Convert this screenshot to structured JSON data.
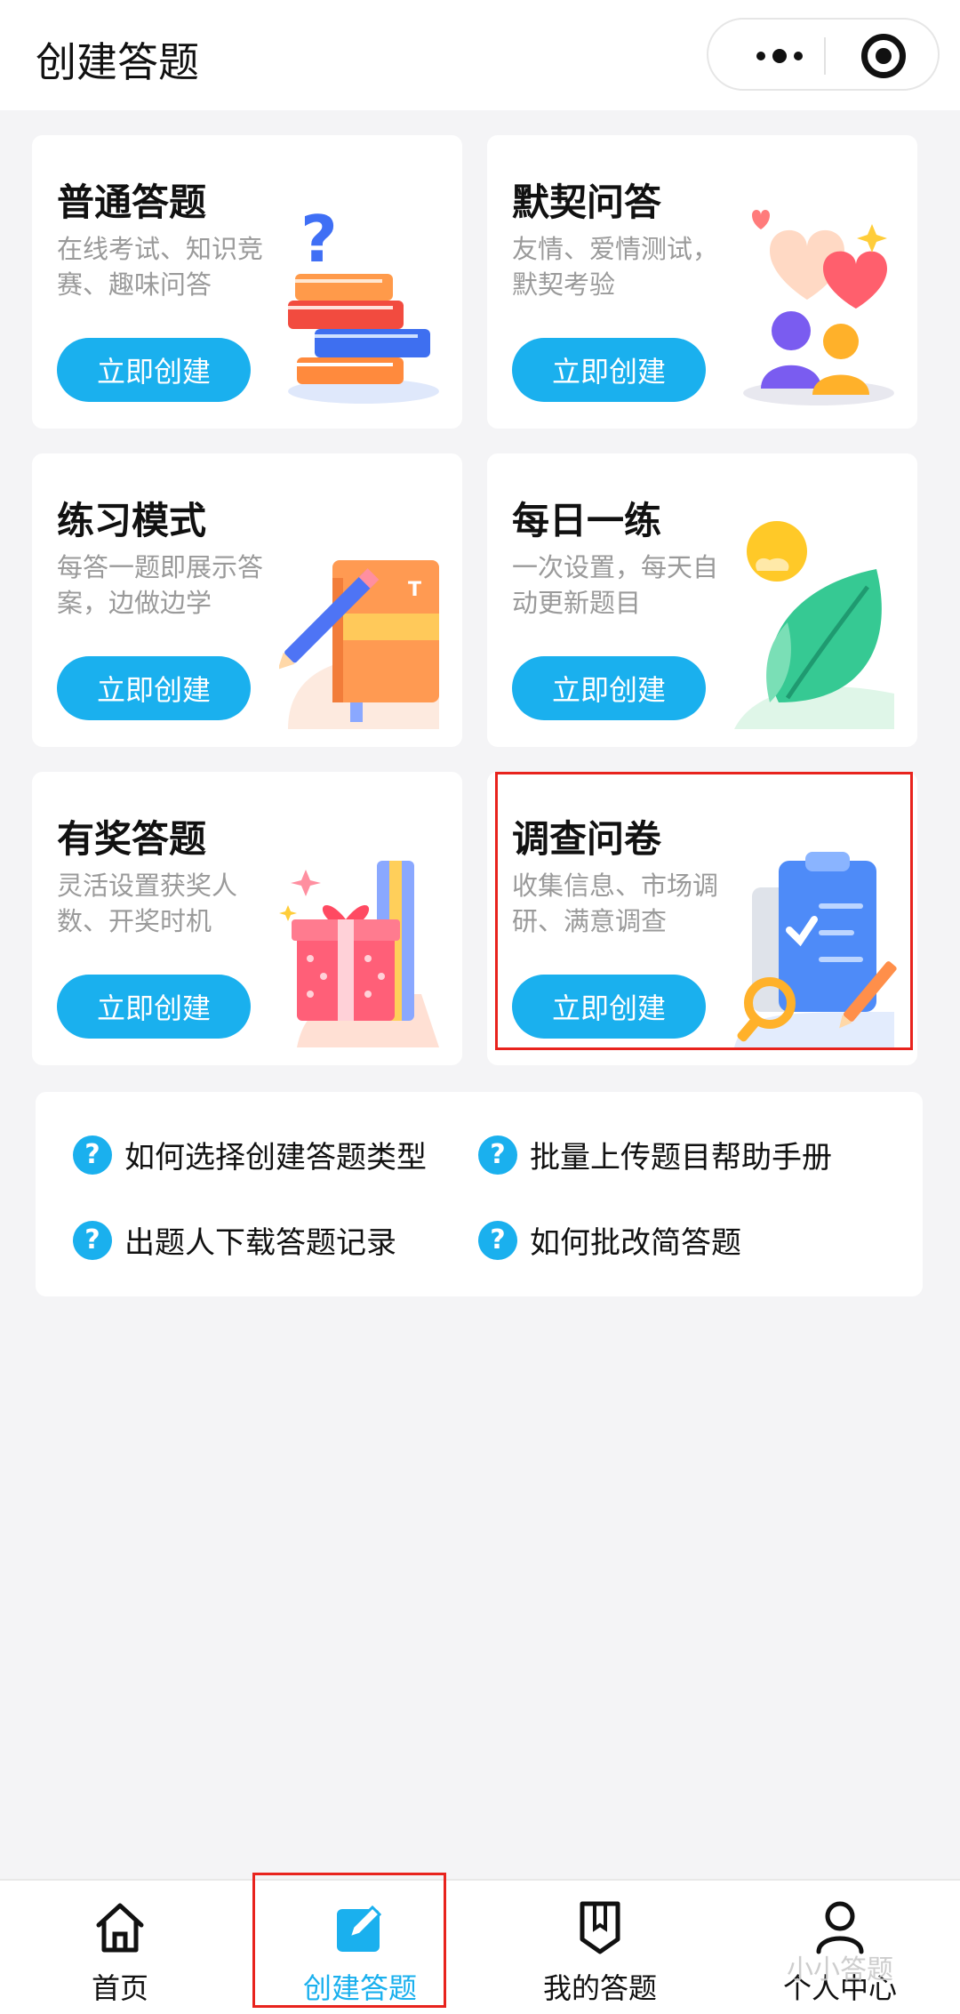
{
  "header": {
    "title": "创建答题"
  },
  "cards": [
    {
      "title": "普通答题",
      "desc": "在线考试、知识竞赛、趣味问答",
      "button": "立即创建"
    },
    {
      "title": "默契问答",
      "desc": "友情、爱情测试，默契考验",
      "button": "立即创建"
    },
    {
      "title": "练习模式",
      "desc": "每答一题即展示答案，边做边学",
      "button": "立即创建"
    },
    {
      "title": "每日一练",
      "desc": "一次设置，每天自动更新题目",
      "button": "立即创建"
    },
    {
      "title": "有奖答题",
      "desc": "灵活设置获奖人数、开奖时机",
      "button": "立即创建"
    },
    {
      "title": "调查问卷",
      "desc": "收集信息、市场调研、满意调查",
      "button": "立即创建"
    }
  ],
  "help": [
    {
      "label": "如何选择创建答题类型",
      "icon": "question-icon"
    },
    {
      "label": "批量上传题目帮助手册",
      "icon": "question-icon"
    },
    {
      "label": "出题人下载答题记录",
      "icon": "question-icon"
    },
    {
      "label": "如何批改简答题",
      "icon": "question-icon"
    }
  ],
  "tabs": [
    {
      "label": "首页",
      "icon": "home-icon"
    },
    {
      "label": "创建答题",
      "icon": "edit-icon",
      "active": true
    },
    {
      "label": "我的答题",
      "icon": "bookmark-icon"
    },
    {
      "label": "个人中心",
      "icon": "user-icon"
    }
  ],
  "watermark": "小小答题",
  "colors": {
    "accent": "#1ab0ee",
    "highlight": "#e8231d",
    "background": "#f4f4f6"
  }
}
